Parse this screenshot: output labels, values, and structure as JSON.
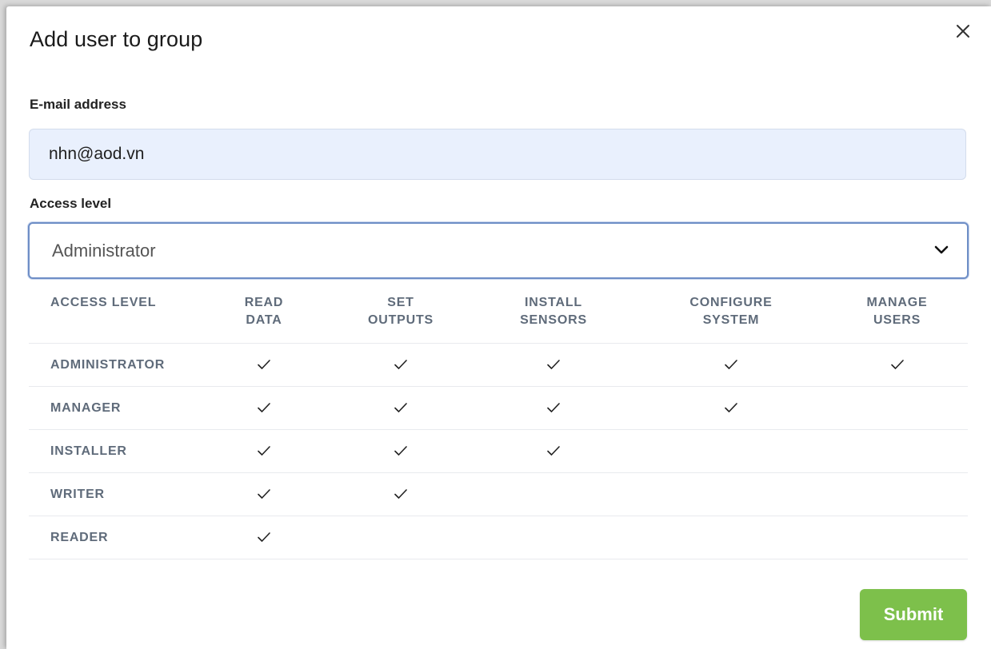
{
  "dialog": {
    "title": "Add user to group",
    "close_icon": "close-icon"
  },
  "email": {
    "label": "E-mail address",
    "value": "nhn@aod.vn"
  },
  "access": {
    "label": "Access level",
    "selected": "Administrator",
    "chevron_icon": "chevron-down-icon"
  },
  "table": {
    "headers": [
      [
        "ACCESS LEVEL"
      ],
      [
        "READ",
        "DATA"
      ],
      [
        "SET",
        "OUTPUTS"
      ],
      [
        "INSTALL",
        "SENSORS"
      ],
      [
        "CONFIGURE",
        "SYSTEM"
      ],
      [
        "MANAGE",
        "USERS"
      ]
    ],
    "rows": [
      {
        "role": "ADMINISTRATOR",
        "perms": [
          true,
          true,
          true,
          true,
          true
        ]
      },
      {
        "role": "MANAGER",
        "perms": [
          true,
          true,
          true,
          true,
          false
        ]
      },
      {
        "role": "INSTALLER",
        "perms": [
          true,
          true,
          true,
          false,
          false
        ]
      },
      {
        "role": "WRITER",
        "perms": [
          true,
          true,
          false,
          false,
          false
        ]
      },
      {
        "role": "READER",
        "perms": [
          true,
          false,
          false,
          false,
          false
        ]
      }
    ]
  },
  "footer": {
    "submit_label": "Submit"
  },
  "colors": {
    "accent": "#7dc04b",
    "input_bg": "#e9f0fd",
    "select_border": "#6e8ec6",
    "muted_text": "#5f6b7a"
  }
}
